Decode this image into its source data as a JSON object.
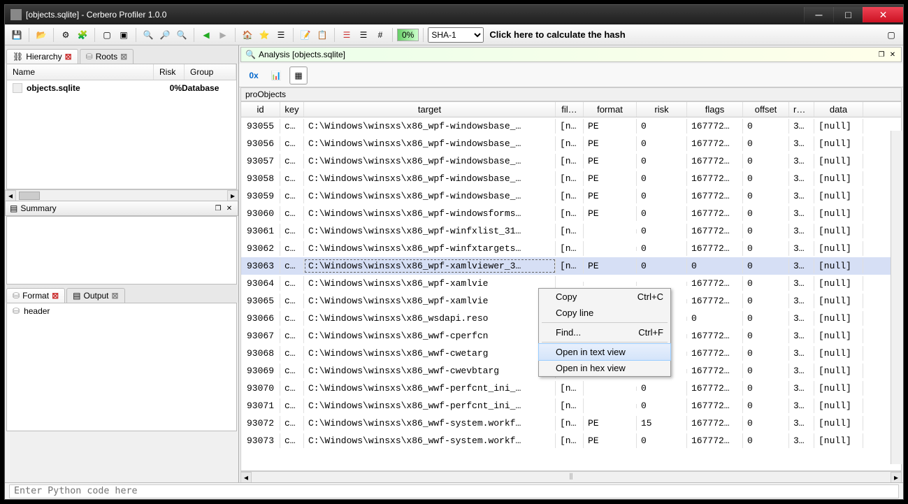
{
  "window": {
    "title": "[objects.sqlite] - Cerbero Profiler 1.0.0"
  },
  "toolbar": {
    "percent": "0%",
    "hash_algo": "SHA-1",
    "hash_hint": "Click here to calculate the hash"
  },
  "left_tabs": {
    "hierarchy": "Hierarchy",
    "roots": "Roots"
  },
  "tree": {
    "cols": {
      "name": "Name",
      "risk": "Risk",
      "group": "Group"
    },
    "rows": [
      {
        "name": "objects.sqlite",
        "risk": "0%",
        "group": "Database"
      }
    ]
  },
  "summary": {
    "title": "Summary"
  },
  "format_tabs": {
    "format": "Format",
    "output": "Output"
  },
  "format_tree": {
    "rows": [
      {
        "name": "header"
      }
    ]
  },
  "analysis": {
    "title": "Analysis [objects.sqlite]"
  },
  "view_buttons": {
    "hex": "0x"
  },
  "table": {
    "name": "proObjects",
    "cols": {
      "id": "id",
      "key": "key",
      "target": "target",
      "fil": "fil…",
      "format": "format",
      "risk": "risk",
      "flags": "flags",
      "offset": "offset",
      "re": "re…",
      "data": "data"
    },
    "rows": [
      {
        "id": "93055",
        "key": "c…",
        "target": "C:\\Windows\\winsxs\\x86_wpf-windowsbase_…",
        "fil": "[n…",
        "format": "PE",
        "risk": "0",
        "flags": "167772…",
        "offset": "0",
        "re": "3…",
        "data": "[null]"
      },
      {
        "id": "93056",
        "key": "c…",
        "target": "C:\\Windows\\winsxs\\x86_wpf-windowsbase_…",
        "fil": "[n…",
        "format": "PE",
        "risk": "0",
        "flags": "167772…",
        "offset": "0",
        "re": "3…",
        "data": "[null]"
      },
      {
        "id": "93057",
        "key": "c…",
        "target": "C:\\Windows\\winsxs\\x86_wpf-windowsbase_…",
        "fil": "[n…",
        "format": "PE",
        "risk": "0",
        "flags": "167772…",
        "offset": "0",
        "re": "3…",
        "data": "[null]"
      },
      {
        "id": "93058",
        "key": "c…",
        "target": "C:\\Windows\\winsxs\\x86_wpf-windowsbase_…",
        "fil": "[n…",
        "format": "PE",
        "risk": "0",
        "flags": "167772…",
        "offset": "0",
        "re": "3…",
        "data": "[null]"
      },
      {
        "id": "93059",
        "key": "c…",
        "target": "C:\\Windows\\winsxs\\x86_wpf-windowsbase_…",
        "fil": "[n…",
        "format": "PE",
        "risk": "0",
        "flags": "167772…",
        "offset": "0",
        "re": "3…",
        "data": "[null]"
      },
      {
        "id": "93060",
        "key": "c…",
        "target": "C:\\Windows\\winsxs\\x86_wpf-windowsforms…",
        "fil": "[n…",
        "format": "PE",
        "risk": "0",
        "flags": "167772…",
        "offset": "0",
        "re": "3…",
        "data": "[null]"
      },
      {
        "id": "93061",
        "key": "c…",
        "target": "C:\\Windows\\winsxs\\x86_wpf-winfxlist_31…",
        "fil": "[n…",
        "format": "",
        "risk": "0",
        "flags": "167772…",
        "offset": "0",
        "re": "3…",
        "data": "[null]"
      },
      {
        "id": "93062",
        "key": "c…",
        "target": "C:\\Windows\\winsxs\\x86_wpf-winfxtargets…",
        "fil": "[n…",
        "format": "",
        "risk": "0",
        "flags": "167772…",
        "offset": "0",
        "re": "3…",
        "data": "[null]"
      },
      {
        "id": "93063",
        "key": "c…",
        "target": "C:\\Windows\\winsxs\\x86_wpf-xamlviewer_3…",
        "fil": "[n…",
        "format": "PE",
        "risk": "0",
        "flags": "0",
        "offset": "0",
        "re": "3…",
        "data": "[null]",
        "selected": true
      },
      {
        "id": "93064",
        "key": "c…",
        "target": "C:\\Windows\\winsxs\\x86_wpf-xamlvie",
        "fil": "",
        "format": "",
        "risk": "",
        "flags": "167772…",
        "offset": "0",
        "re": "3…",
        "data": "[null]"
      },
      {
        "id": "93065",
        "key": "c…",
        "target": "C:\\Windows\\winsxs\\x86_wpf-xamlvie",
        "fil": "",
        "format": "",
        "risk": "",
        "flags": "167772…",
        "offset": "0",
        "re": "3…",
        "data": "[null]"
      },
      {
        "id": "93066",
        "key": "c…",
        "target": "C:\\Windows\\winsxs\\x86_wsdapi.reso",
        "fil": "",
        "format": "",
        "risk": "",
        "flags": "0",
        "offset": "0",
        "re": "3…",
        "data": "[null]"
      },
      {
        "id": "93067",
        "key": "c…",
        "target": "C:\\Windows\\winsxs\\x86_wwf-cperfcn",
        "fil": "",
        "format": "",
        "risk": "",
        "flags": "167772…",
        "offset": "0",
        "re": "3…",
        "data": "[null]"
      },
      {
        "id": "93068",
        "key": "c…",
        "target": "C:\\Windows\\winsxs\\x86_wwf-cwetarg",
        "fil": "",
        "format": "",
        "risk": "",
        "flags": "167772…",
        "offset": "0",
        "re": "3…",
        "data": "[null]"
      },
      {
        "id": "93069",
        "key": "c…",
        "target": "C:\\Windows\\winsxs\\x86_wwf-cwevbtarg",
        "fil": "",
        "format": "",
        "risk": "",
        "flags": "167772…",
        "offset": "0",
        "re": "3…",
        "data": "[null]"
      },
      {
        "id": "93070",
        "key": "c…",
        "target": "C:\\Windows\\winsxs\\x86_wwf-perfcnt_ini_…",
        "fil": "[n…",
        "format": "",
        "risk": "0",
        "flags": "167772…",
        "offset": "0",
        "re": "3…",
        "data": "[null]"
      },
      {
        "id": "93071",
        "key": "c…",
        "target": "C:\\Windows\\winsxs\\x86_wwf-perfcnt_ini_…",
        "fil": "[n…",
        "format": "",
        "risk": "0",
        "flags": "167772…",
        "offset": "0",
        "re": "3…",
        "data": "[null]"
      },
      {
        "id": "93072",
        "key": "c…",
        "target": "C:\\Windows\\winsxs\\x86_wwf-system.workf…",
        "fil": "[n…",
        "format": "PE",
        "risk": "15",
        "flags": "167772…",
        "offset": "0",
        "re": "3…",
        "data": "[null]"
      },
      {
        "id": "93073",
        "key": "c…",
        "target": "C:\\Windows\\winsxs\\x86_wwf-system.workf…",
        "fil": "[n…",
        "format": "PE",
        "risk": "0",
        "flags": "167772…",
        "offset": "0",
        "re": "3…",
        "data": "[null]"
      }
    ]
  },
  "contextmenu": {
    "copy": "Copy",
    "copy_sc": "Ctrl+C",
    "copyline": "Copy line",
    "find": "Find...",
    "find_sc": "Ctrl+F",
    "open_text": "Open in text view",
    "open_hex": "Open in hex view"
  },
  "statusbar": {
    "python_placeholder": "Enter Python code here"
  }
}
